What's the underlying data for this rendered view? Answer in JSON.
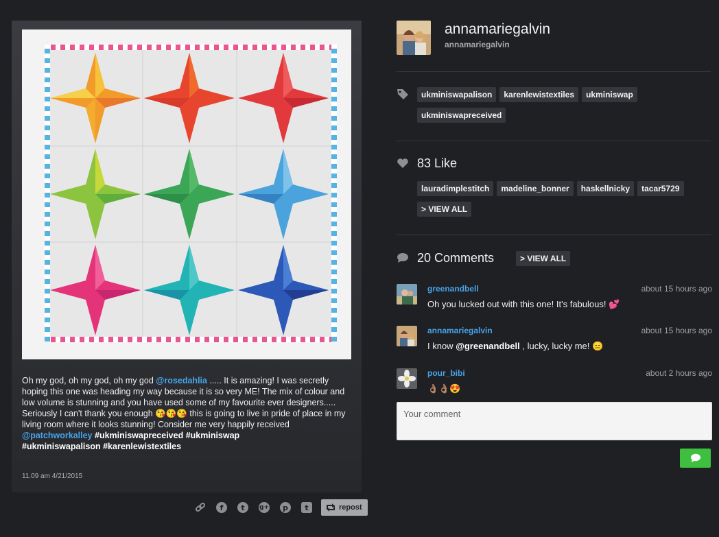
{
  "post": {
    "image_alt": "",
    "caption": {
      "p1": "Oh my god, oh my god, oh my god ",
      "mention1": "@rosedahlia",
      "p2": " ..... It is amazing! I was secretly hoping this one was heading my way because it is so very ME! The mix of colour and low volume is stunning and you have used some of my favourite ever designers..... Seriously I can't thank you enough ",
      "emoji1": "😘😘😘",
      "p3": " this is going to live in pride of place in my living room where it looks stunning! Consider me very happily received ",
      "mention2": "@patchworkalley",
      "tag1": " #ukminiswapreceived",
      "tag2": " #ukminiswap",
      "tag3": "#ukminiswapalison",
      "tag4": " #karenlewistextiles"
    },
    "date": "11.09 am 4/21/2015"
  },
  "share": {
    "link_icon": "🔗",
    "facebook": "f",
    "twitter": "t",
    "googleplus": "g+",
    "pinterest": "p",
    "tumblr": "t",
    "repost_label": "repost"
  },
  "profile": {
    "name": "annamariegalvin",
    "handle": "annamariegalvin"
  },
  "tags": [
    "ukminiswapalison",
    "karenlewistextiles",
    "ukminiswap",
    "ukminiswapreceived"
  ],
  "likes": {
    "title": "83 Like",
    "users": [
      "lauradimplestitch",
      "madeline_bonner",
      "haskellnicky",
      "tacar5729"
    ],
    "view_all": "> VIEW ALL"
  },
  "comments": {
    "title": "20 Comments",
    "view_all": "> VIEW ALL",
    "items": [
      {
        "user": "greenandbell",
        "time": "about 15 hours ago",
        "text": "Oh you lucked out with this one! It's fabulous! ",
        "emoji": "💕"
      },
      {
        "user": "annamariegalvin",
        "time": "about 15 hours ago",
        "pre": "I know ",
        "mention": "@greenandbell",
        "post": " , lucky, lucky me! ",
        "emoji": "😑"
      },
      {
        "user": "pour_bibi",
        "time": "about 2 hours ago",
        "text": "👌🏽👌🏽😍"
      }
    ],
    "placeholder": "Your comment"
  },
  "colors": {
    "background": "#1f2024",
    "link": "#47a3e8",
    "send_button": "#3fbf3f"
  }
}
